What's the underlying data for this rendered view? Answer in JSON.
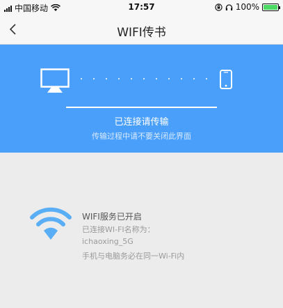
{
  "status_bar": {
    "carrier": "中国移动",
    "time": "17:57",
    "battery_percent": "100%",
    "battery_level": 1.0,
    "battery_color": "#4cd964"
  },
  "nav": {
    "title": "WIFI传书",
    "back_icon": "chevron-left-icon"
  },
  "transfer": {
    "accent": "#4a9ffb",
    "status": "已连接请传输",
    "hint": "传输过程中请不要关闭此界面",
    "source_icon": "monitor-icon",
    "target_icon": "phone-icon"
  },
  "wifi": {
    "icon": "wifi-icon",
    "icon_color": "#5aaef5",
    "title": "WIFI服务已开启",
    "connected_label": "已连接WI-FI名称为：",
    "ssid": "ichaoxing_5G",
    "note": "手机与电脑务必在同一Wi-Fi内"
  }
}
